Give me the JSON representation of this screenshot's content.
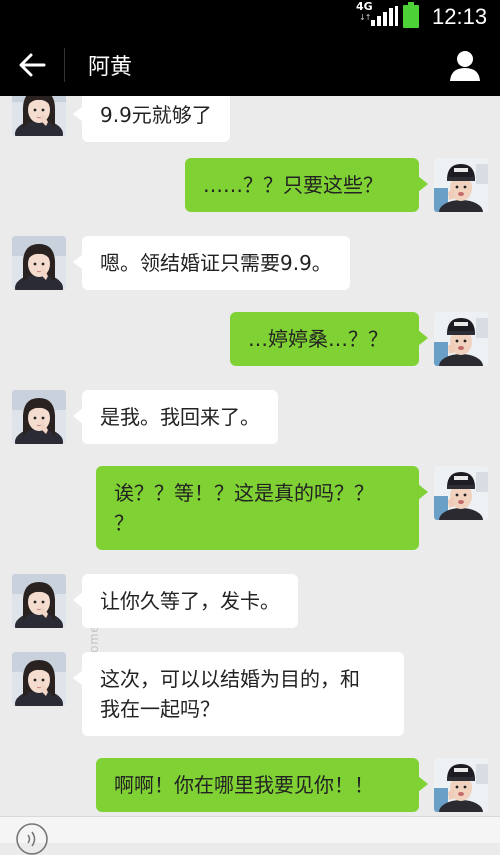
{
  "status_bar": {
    "network": "4G",
    "time": "12:13"
  },
  "header": {
    "title": "阿黄"
  },
  "messages": [
    {
      "side": "left",
      "text": "9.9元就够了"
    },
    {
      "side": "right",
      "text": "……？？只要这些？"
    },
    {
      "side": "left",
      "text": "嗯。领结婚证只需要9.9。"
    },
    {
      "side": "right",
      "text": "…婷婷桑…？？"
    },
    {
      "side": "left",
      "text": "是我。我回来了。"
    },
    {
      "side": "right",
      "text": "诶？？等！？这是真的吗？？\n？"
    },
    {
      "side": "left",
      "text": "让你久等了，发卡。"
    },
    {
      "side": "left",
      "text": "这次，可以以结婚为目的，和\n我在一起吗？"
    },
    {
      "side": "right",
      "text": "啊啊！你在哪里我要见你！！"
    }
  ],
  "colors": {
    "chat_background": "#ebebeb",
    "outgoing_bubble": "#80d234",
    "incoming_bubble": "#ffffff",
    "header": "#000000"
  }
}
